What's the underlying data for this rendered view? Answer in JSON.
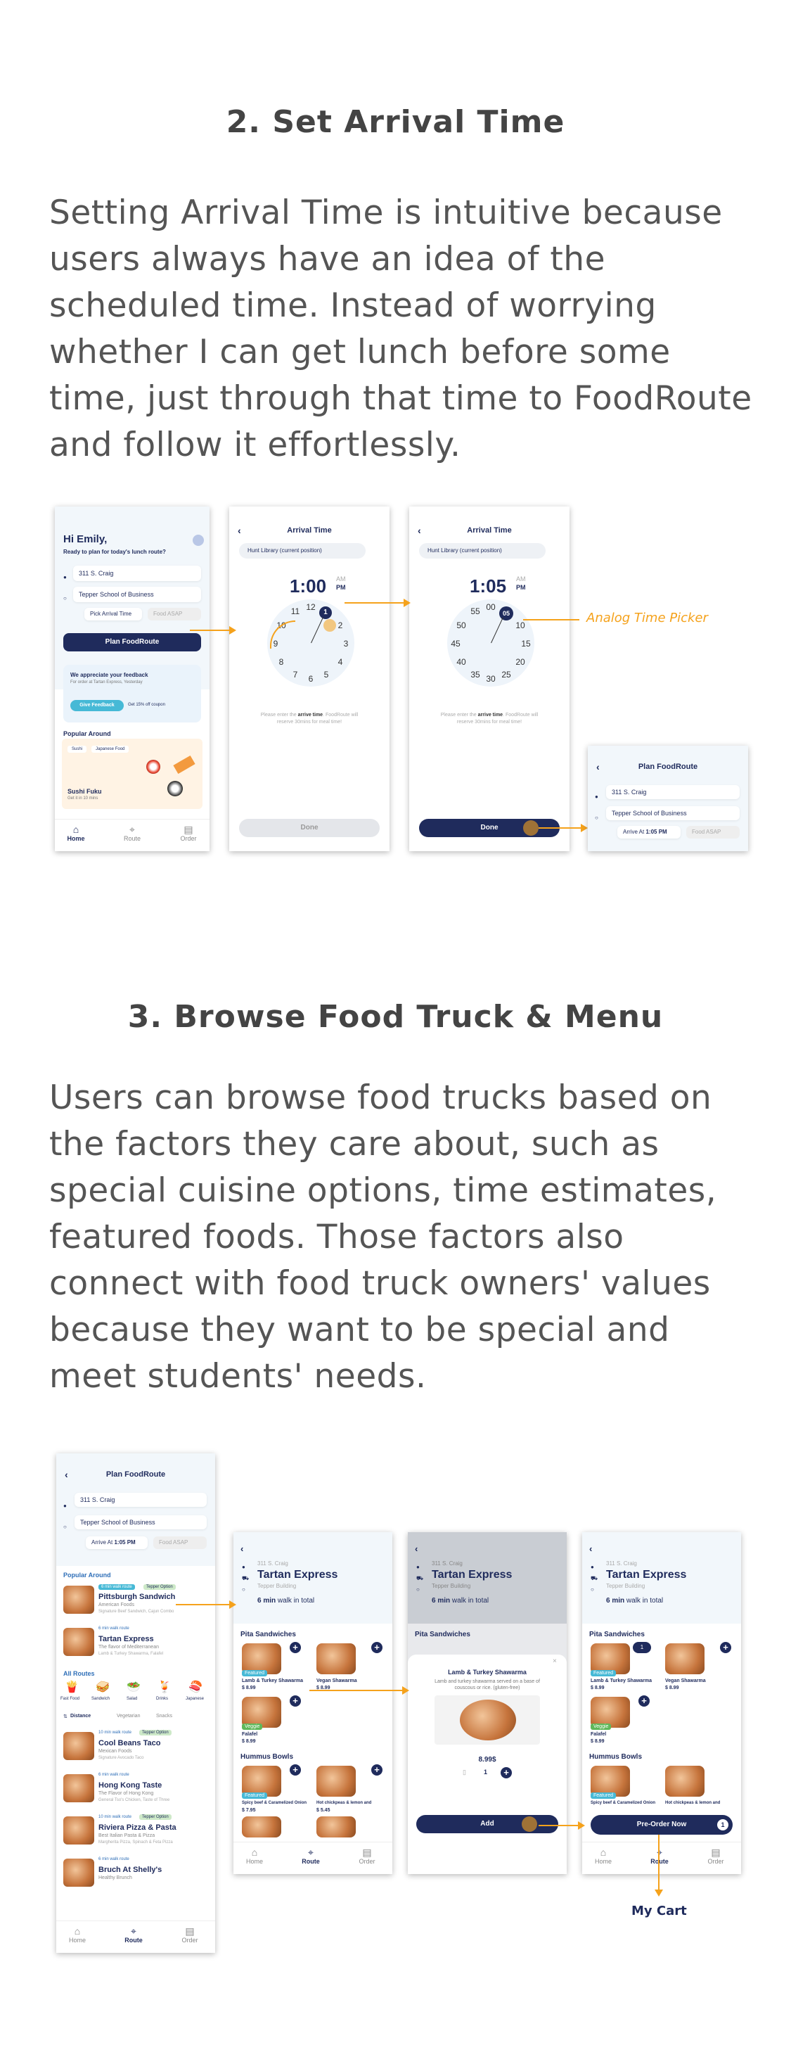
{
  "section2": {
    "title": "2. Set Arrival Time",
    "body": "Setting Arrival Time is intuitive because users always have an idea of the scheduled time. Instead of worrying whether I can get lunch before some time, just through that time to FoodRoute and follow it effortlessly."
  },
  "section3": {
    "title": "3. Browse Food Truck & Menu",
    "body": "Users can browse food trucks based on the factors they care about, such as special cuisine options, time estimates, featured foods. Those factors also connect with food truck owners' values because they want to be special and meet students' needs."
  },
  "home": {
    "greeting": "Hi Emily,",
    "prompt": "Ready to plan for today's lunch route?",
    "from": "311 S. Craig",
    "to": "Tepper School of Business",
    "pick_time": "Pick Arrival Time",
    "asap": "Food ASAP",
    "plan_button": "Plan FoodRoute",
    "feedback_title": "We appreciate your feedback",
    "feedback_sub": "For order at Tartan Express, Yesterday",
    "give_feedback": "Give Feedback",
    "coupon": "Get 15% off coupon",
    "popular": "Popular Around",
    "chips": [
      "Sushi",
      "Japanese Food"
    ],
    "featured_name": "Sushi Fuku",
    "featured_sub": "Get it in 10 mins"
  },
  "tabs": {
    "home": "Home",
    "route": "Route",
    "order": "Order"
  },
  "arrival": {
    "title": "Arrival Time",
    "location": "Hunt Library (current position)",
    "time1": "1:00",
    "time2": "1:05",
    "am": "AM",
    "pm": "PM",
    "hour_selected": "1",
    "minute_selected": "05",
    "hours": [
      "12",
      "1",
      "2",
      "3",
      "4",
      "5",
      "6",
      "7",
      "8",
      "9",
      "10",
      "11"
    ],
    "minutes": [
      "00",
      "05",
      "10",
      "15",
      "20",
      "25",
      "30",
      "35",
      "40",
      "45",
      "50",
      "55"
    ],
    "hint_pre": "Please enter the ",
    "hint_bold": "arrive time",
    "hint_post": ". FoodRoute will reserve 30mins for meal time!",
    "done": "Done",
    "annotation": "Analog Time Picker"
  },
  "plan": {
    "title": "Plan FoodRoute",
    "from": "311 S. Craig",
    "to": "Tepper School of Business",
    "arrive_at": "Arrive At",
    "arrive_time": "1:05 PM",
    "asap": "Food ASAP",
    "popular": "Popular Around",
    "all_routes": "All Routes",
    "categories": [
      "Fast Food",
      "Sandwich",
      "Salad",
      "Drinks",
      "Japanese"
    ],
    "filters": [
      "Distance",
      "Vegetarian",
      "Snacks"
    ],
    "trucks": [
      {
        "walk": "6 min walk route",
        "tag": "Tepper Option",
        "name": "Pittsburgh Sandwich",
        "cuisine": "American Foods",
        "sig": "Signature Beef Sandwich, Cajun Combo"
      },
      {
        "walk": "6 min walk route",
        "tag": "",
        "name": "Tartan Express",
        "cuisine": "The flavor of Mediterranean",
        "sig": "Lamb & Turkey Shawarma, Falafel"
      },
      {
        "walk": "10 min walk route",
        "tag": "Tepper Option",
        "name": "Cool Beans Taco",
        "cuisine": "Mexican Foods",
        "sig": "Signature Avocado Taco"
      },
      {
        "walk": "6 min walk route",
        "tag": "",
        "name": "Hong Kong Taste",
        "cuisine": "The Flavor of Hong Kong",
        "sig": "General Tso's Chicken, Taste of Three"
      },
      {
        "walk": "10 min walk route",
        "tag": "Tepper Option",
        "name": "Riviera Pizza & Pasta",
        "cuisine": "Best Italian Pasta & Pizza",
        "sig": "Margherita Pizza, Spinach & Feta Pizza"
      },
      {
        "walk": "6 min walk route",
        "tag": "",
        "name": "Bruch At Shelly's",
        "cuisine": "Healthy Brunch",
        "sig": ""
      }
    ]
  },
  "menu": {
    "from": "311 S. Craig",
    "truck": "Tartan Express",
    "via": "Tepper Building",
    "walk_bold": "6 min",
    "walk_rest": "walk in total",
    "cat1": "Pita Sandwiches",
    "cat2": "Hummus Bowls",
    "items": [
      {
        "name": "Lamb & Turkey Shawarma",
        "price": "$ 8.99",
        "badge": "Featured"
      },
      {
        "name": "Vegan Shawarma",
        "price": "$ 8.99",
        "badge": ""
      },
      {
        "name": "Falafel",
        "price": "$ 8.99",
        "badge": "Veggie"
      },
      {
        "name": "Spicy beef & Caramelized Onion",
        "price": "$ 7.95",
        "badge": "Featured"
      },
      {
        "name": "Hot chickpeas & lemon and",
        "price": "$ 5.45",
        "badge": ""
      }
    ],
    "modal_name": "Lamb & Turkey Shawarma",
    "modal_desc": "Lamb and turkey shawarma served on a base of couscous or rice. (gluten-free)",
    "modal_price": "8.99$",
    "modal_qty": "1",
    "add": "Add",
    "preorder": "Pre-Order Now",
    "cart_count": "1",
    "cart_label": "My Cart"
  },
  "colors": {
    "navy": "#1f2b5c",
    "accent": "#f5a21c",
    "teal": "#46b9d6"
  }
}
